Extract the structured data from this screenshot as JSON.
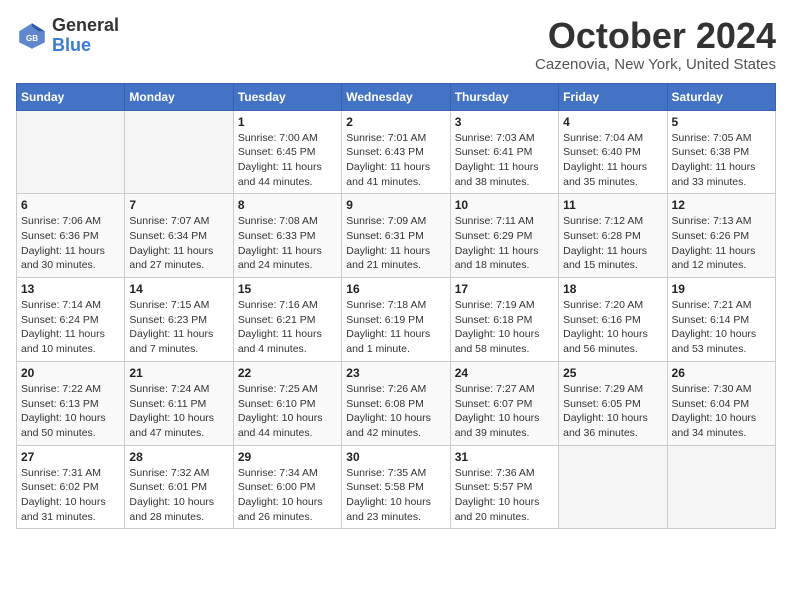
{
  "header": {
    "logo_general": "General",
    "logo_blue": "Blue",
    "month_title": "October 2024",
    "location": "Cazenovia, New York, United States"
  },
  "days_of_week": [
    "Sunday",
    "Monday",
    "Tuesday",
    "Wednesday",
    "Thursday",
    "Friday",
    "Saturday"
  ],
  "weeks": [
    [
      {
        "day": "",
        "info": ""
      },
      {
        "day": "",
        "info": ""
      },
      {
        "day": "1",
        "info": "Sunrise: 7:00 AM\nSunset: 6:45 PM\nDaylight: 11 hours and 44 minutes."
      },
      {
        "day": "2",
        "info": "Sunrise: 7:01 AM\nSunset: 6:43 PM\nDaylight: 11 hours and 41 minutes."
      },
      {
        "day": "3",
        "info": "Sunrise: 7:03 AM\nSunset: 6:41 PM\nDaylight: 11 hours and 38 minutes."
      },
      {
        "day": "4",
        "info": "Sunrise: 7:04 AM\nSunset: 6:40 PM\nDaylight: 11 hours and 35 minutes."
      },
      {
        "day": "5",
        "info": "Sunrise: 7:05 AM\nSunset: 6:38 PM\nDaylight: 11 hours and 33 minutes."
      }
    ],
    [
      {
        "day": "6",
        "info": "Sunrise: 7:06 AM\nSunset: 6:36 PM\nDaylight: 11 hours and 30 minutes."
      },
      {
        "day": "7",
        "info": "Sunrise: 7:07 AM\nSunset: 6:34 PM\nDaylight: 11 hours and 27 minutes."
      },
      {
        "day": "8",
        "info": "Sunrise: 7:08 AM\nSunset: 6:33 PM\nDaylight: 11 hours and 24 minutes."
      },
      {
        "day": "9",
        "info": "Sunrise: 7:09 AM\nSunset: 6:31 PM\nDaylight: 11 hours and 21 minutes."
      },
      {
        "day": "10",
        "info": "Sunrise: 7:11 AM\nSunset: 6:29 PM\nDaylight: 11 hours and 18 minutes."
      },
      {
        "day": "11",
        "info": "Sunrise: 7:12 AM\nSunset: 6:28 PM\nDaylight: 11 hours and 15 minutes."
      },
      {
        "day": "12",
        "info": "Sunrise: 7:13 AM\nSunset: 6:26 PM\nDaylight: 11 hours and 12 minutes."
      }
    ],
    [
      {
        "day": "13",
        "info": "Sunrise: 7:14 AM\nSunset: 6:24 PM\nDaylight: 11 hours and 10 minutes."
      },
      {
        "day": "14",
        "info": "Sunrise: 7:15 AM\nSunset: 6:23 PM\nDaylight: 11 hours and 7 minutes."
      },
      {
        "day": "15",
        "info": "Sunrise: 7:16 AM\nSunset: 6:21 PM\nDaylight: 11 hours and 4 minutes."
      },
      {
        "day": "16",
        "info": "Sunrise: 7:18 AM\nSunset: 6:19 PM\nDaylight: 11 hours and 1 minute."
      },
      {
        "day": "17",
        "info": "Sunrise: 7:19 AM\nSunset: 6:18 PM\nDaylight: 10 hours and 58 minutes."
      },
      {
        "day": "18",
        "info": "Sunrise: 7:20 AM\nSunset: 6:16 PM\nDaylight: 10 hours and 56 minutes."
      },
      {
        "day": "19",
        "info": "Sunrise: 7:21 AM\nSunset: 6:14 PM\nDaylight: 10 hours and 53 minutes."
      }
    ],
    [
      {
        "day": "20",
        "info": "Sunrise: 7:22 AM\nSunset: 6:13 PM\nDaylight: 10 hours and 50 minutes."
      },
      {
        "day": "21",
        "info": "Sunrise: 7:24 AM\nSunset: 6:11 PM\nDaylight: 10 hours and 47 minutes."
      },
      {
        "day": "22",
        "info": "Sunrise: 7:25 AM\nSunset: 6:10 PM\nDaylight: 10 hours and 44 minutes."
      },
      {
        "day": "23",
        "info": "Sunrise: 7:26 AM\nSunset: 6:08 PM\nDaylight: 10 hours and 42 minutes."
      },
      {
        "day": "24",
        "info": "Sunrise: 7:27 AM\nSunset: 6:07 PM\nDaylight: 10 hours and 39 minutes."
      },
      {
        "day": "25",
        "info": "Sunrise: 7:29 AM\nSunset: 6:05 PM\nDaylight: 10 hours and 36 minutes."
      },
      {
        "day": "26",
        "info": "Sunrise: 7:30 AM\nSunset: 6:04 PM\nDaylight: 10 hours and 34 minutes."
      }
    ],
    [
      {
        "day": "27",
        "info": "Sunrise: 7:31 AM\nSunset: 6:02 PM\nDaylight: 10 hours and 31 minutes."
      },
      {
        "day": "28",
        "info": "Sunrise: 7:32 AM\nSunset: 6:01 PM\nDaylight: 10 hours and 28 minutes."
      },
      {
        "day": "29",
        "info": "Sunrise: 7:34 AM\nSunset: 6:00 PM\nDaylight: 10 hours and 26 minutes."
      },
      {
        "day": "30",
        "info": "Sunrise: 7:35 AM\nSunset: 5:58 PM\nDaylight: 10 hours and 23 minutes."
      },
      {
        "day": "31",
        "info": "Sunrise: 7:36 AM\nSunset: 5:57 PM\nDaylight: 10 hours and 20 minutes."
      },
      {
        "day": "",
        "info": ""
      },
      {
        "day": "",
        "info": ""
      }
    ]
  ]
}
